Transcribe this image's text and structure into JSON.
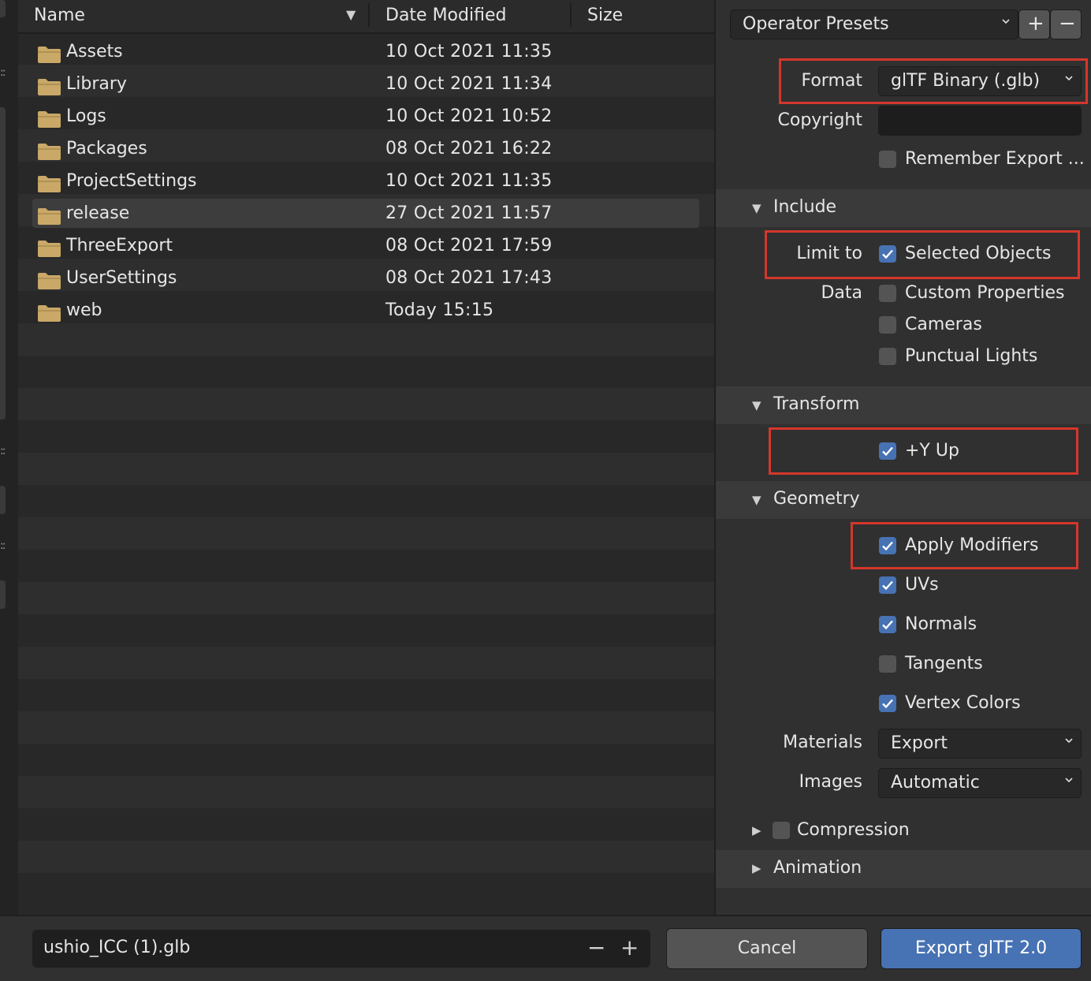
{
  "header": {
    "name": "Name",
    "date_modified": "Date Modified",
    "size": "Size"
  },
  "files": [
    {
      "name": "Assets",
      "date": "10 Oct 2021 11:35"
    },
    {
      "name": "Library",
      "date": "10 Oct 2021 11:34"
    },
    {
      "name": "Logs",
      "date": "10 Oct 2021 10:52"
    },
    {
      "name": "Packages",
      "date": "08 Oct 2021 16:22"
    },
    {
      "name": "ProjectSettings",
      "date": "10 Oct 2021 11:35"
    },
    {
      "name": "release",
      "date": "27 Oct 2021 11:57",
      "selected": true
    },
    {
      "name": "ThreeExport",
      "date": "08 Oct 2021 17:59"
    },
    {
      "name": "UserSettings",
      "date": "08 Oct 2021 17:43"
    },
    {
      "name": "web",
      "date": "Today 15:15"
    }
  ],
  "presets": {
    "label": "Operator Presets",
    "add": "+",
    "remove": "−"
  },
  "export_settings": {
    "format_label": "Format",
    "format_value": "glTF Binary (.glb)",
    "copyright_label": "Copyright",
    "copyright_value": "",
    "remember_label": "Remember Export ...",
    "remember_checked": false
  },
  "include": {
    "title": "Include",
    "limit_to_label": "Limit to",
    "selected_objects": {
      "label": "Selected Objects",
      "checked": true
    },
    "data_label": "Data",
    "custom_properties": {
      "label": "Custom Properties",
      "checked": false
    },
    "cameras": {
      "label": "Cameras",
      "checked": false
    },
    "punctual_lights": {
      "label": "Punctual Lights",
      "checked": false
    }
  },
  "transform": {
    "title": "Transform",
    "y_up": {
      "label": "+Y Up",
      "checked": true
    }
  },
  "geometry": {
    "title": "Geometry",
    "apply_modifiers": {
      "label": "Apply Modifiers",
      "checked": true
    },
    "uvs": {
      "label": "UVs",
      "checked": true
    },
    "normals": {
      "label": "Normals",
      "checked": true
    },
    "tangents": {
      "label": "Tangents",
      "checked": false
    },
    "vertex_colors": {
      "label": "Vertex Colors",
      "checked": true
    },
    "materials_label": "Materials",
    "materials_value": "Export",
    "images_label": "Images",
    "images_value": "Automatic"
  },
  "compression": {
    "title": "Compression",
    "checked": false
  },
  "animation": {
    "title": "Animation"
  },
  "footer": {
    "filename": "ushio_ICC (1).glb",
    "decrement": "−",
    "increment": "+",
    "cancel": "Cancel",
    "export": "Export glTF 2.0"
  },
  "colors": {
    "accent": "#4772b3",
    "highlight": "#d4372b",
    "folder": "#c9a868"
  }
}
